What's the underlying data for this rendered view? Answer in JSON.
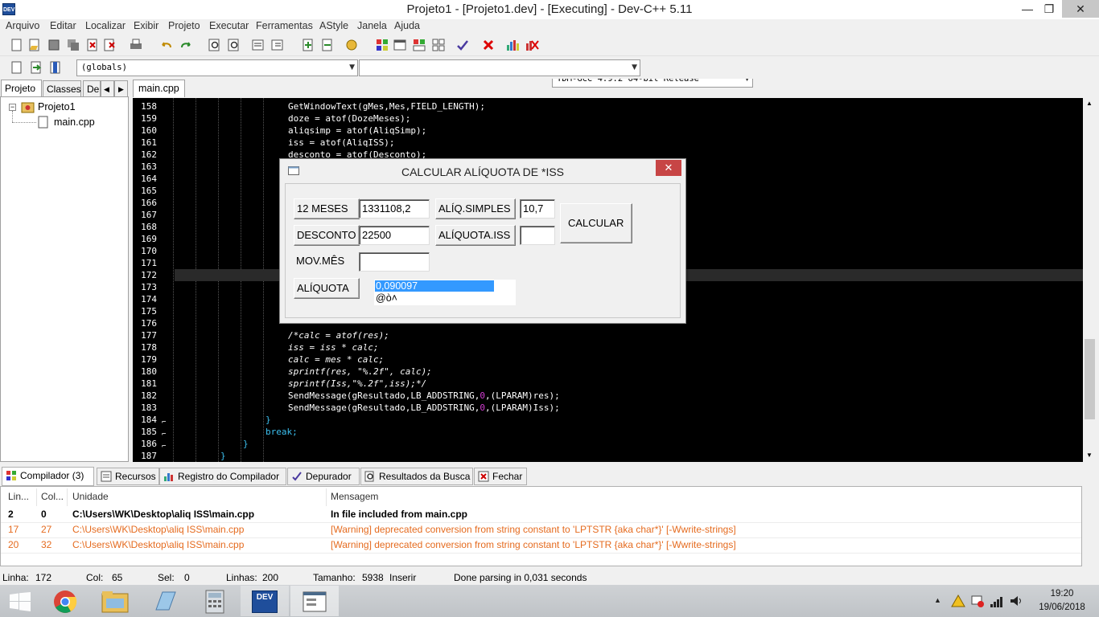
{
  "window": {
    "title": "Projeto1 - [Projeto1.dev] - [Executing] - Dev-C++ 5.11",
    "app_icon_text": "DEV",
    "minimize": "—",
    "restore": "❐",
    "close": "✕"
  },
  "menu": [
    "Arquivo",
    "Editar",
    "Localizar",
    "Exibir",
    "Projeto",
    "Executar",
    "Ferramentas",
    "AStyle",
    "Janela",
    "Ajuda"
  ],
  "toolbar": {
    "compiler_select": "TDM-GCC 4.9.2 64-bit Release",
    "scope_select": "(globals)",
    "function_select": ""
  },
  "left_panel": {
    "tabs": [
      "Projeto",
      "Classes",
      "De"
    ],
    "tree": {
      "project": "Projeto1",
      "file": "main.cpp"
    }
  },
  "editor": {
    "tab": "main.cpp",
    "line_numbers": [
      "158",
      "159",
      "160",
      "161",
      "162",
      "163",
      "164",
      "165",
      "166",
      "167",
      "168",
      "169",
      "170",
      "171",
      "172",
      "173",
      "174",
      "175",
      "176",
      "177",
      "178",
      "179",
      "180",
      "181",
      "182",
      "183",
      "184",
      "185",
      "186",
      "187"
    ],
    "lines": {
      "l158": "GetWindowText(gMes,Mes,FIELD_LENGTH);",
      "l159": "doze = atof(DozeMeses);",
      "l160": "aliqsimp = atof(AliqSimp);",
      "l161": "iss = atof(AliqISS);",
      "l162": "desconto = atof(Desconto);",
      "l177": "/*calc = atof(res);",
      "l178": "iss = iss * calc;",
      "l179": "calc = mes * calc;",
      "l180": "sprintf(res, \"%.2f\", calc);",
      "l181": "sprintf(Iss,\"%.2f\",iss);*/",
      "l182a": "SendMessage(gResultado,LB_ADDSTRING,",
      "l182b": "0",
      "l182c": ",(LPARAM)res);",
      "l183a": "SendMessage(gResultado,LB_ADDSTRING,",
      "l183b": "0",
      "l183c": ",(LPARAM)Iss);",
      "l184": "}",
      "l185": "break;",
      "l186": "}",
      "l187": "}"
    }
  },
  "dialog": {
    "title": "CALCULAR ALÍQUOTA DE *ISS",
    "close": "✕",
    "btn_12meses": "12 MESES",
    "val_12meses": "1331108,2",
    "btn_aliq_simples": "ALÍQ.SIMPLES",
    "val_aliq_simples": "10,7",
    "btn_calcular": "CALCULAR",
    "btn_desconto": "DESCONTO",
    "val_desconto": "22500",
    "btn_aliquota_iss": "ALÍQUOTA.ISS",
    "val_aliquota_iss": "",
    "btn_mov_mes": "MOV.MÊS",
    "val_mov_mes": "",
    "btn_aliquota": "ALÍQUOTA",
    "result_items": [
      "0,090097",
      "@ò˄"
    ]
  },
  "bottom_tabs": [
    "Compilador (3)",
    "Recursos",
    "Registro do Compilador",
    "Depurador",
    "Resultados da Busca",
    "Fechar"
  ],
  "messages": {
    "columns": [
      "Lin...",
      "Col...",
      "Unidade",
      "Mensagem"
    ],
    "rows": [
      {
        "lin": "2",
        "col": "0",
        "unit": "C:\\Users\\WK\\Desktop\\aliq ISS\\main.cpp",
        "msg": "In file included from main.cpp"
      },
      {
        "lin": "17",
        "col": "27",
        "unit": "C:\\Users\\WK\\Desktop\\aliq ISS\\main.cpp",
        "msg": "[Warning] deprecated conversion from string constant to 'LPTSTR {aka char*}' [-Wwrite-strings]"
      },
      {
        "lin": "20",
        "col": "32",
        "unit": "C:\\Users\\WK\\Desktop\\aliq ISS\\main.cpp",
        "msg": "[Warning] deprecated conversion from string constant to 'LPTSTR {aka char*}' [-Wwrite-strings]"
      }
    ]
  },
  "status": {
    "linha_label": "Linha:",
    "linha": "172",
    "col_label": "Col:",
    "col": "65",
    "sel_label": "Sel:",
    "sel": "0",
    "linhas_label": "Linhas:",
    "linhas": "200",
    "tamanho_label": "Tamanho:",
    "tamanho": "5938",
    "mode": "Inserir",
    "message": "Done parsing in 0,031 seconds"
  },
  "taskbar": {
    "time": "19:20",
    "date": "19/06/2018",
    "dev_icon_text": "DEV"
  },
  "colors": {
    "keyword": "#3cc0f0",
    "number": "#d23dd2",
    "warning": "#e56b1f",
    "selection": "#3399ff"
  }
}
